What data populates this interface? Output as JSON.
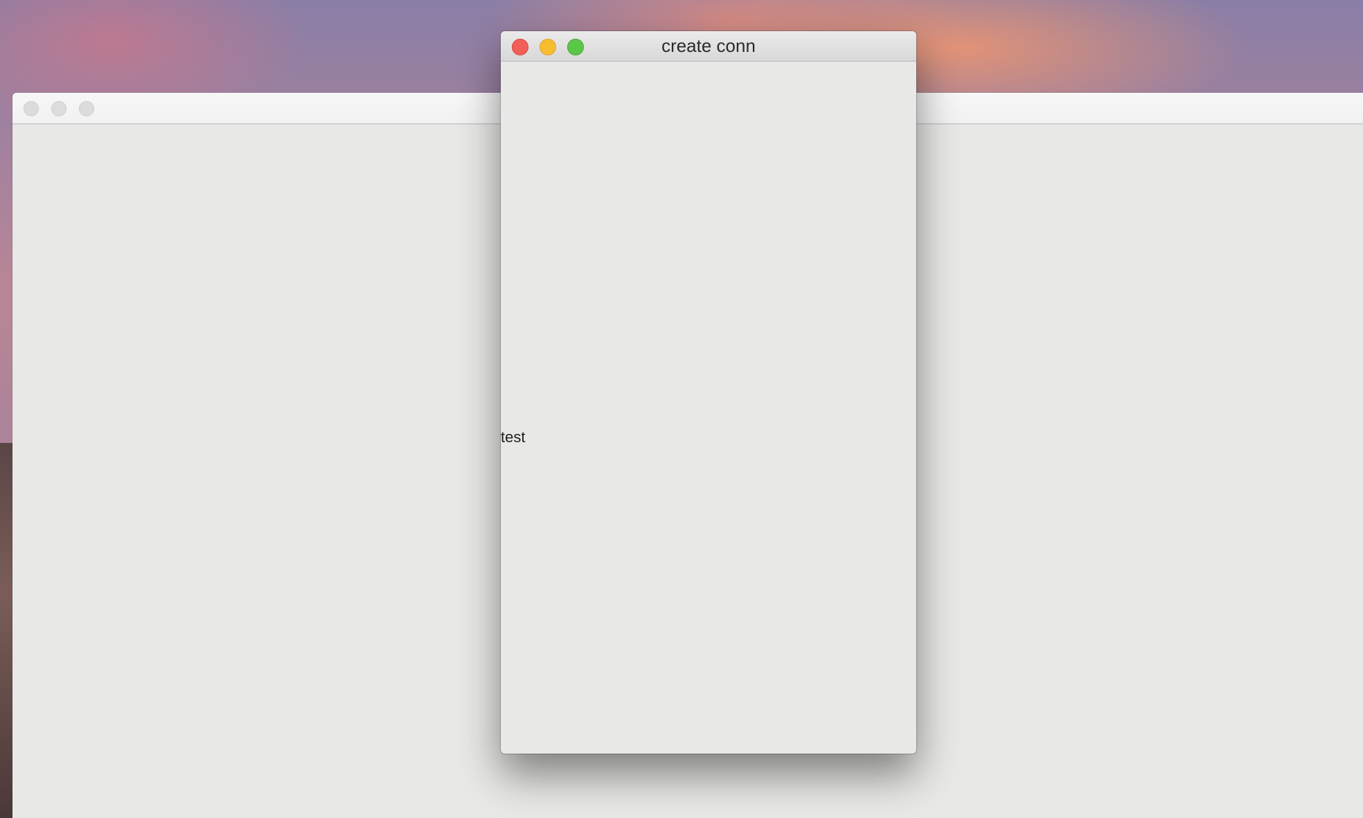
{
  "background_window": {
    "title": ""
  },
  "dialog": {
    "title": "create conn",
    "label": "test"
  },
  "colors": {
    "close": "#f05f58",
    "minimize": "#f7bd2f",
    "zoom": "#5bc747",
    "window_bg": "#e8e8e6"
  }
}
